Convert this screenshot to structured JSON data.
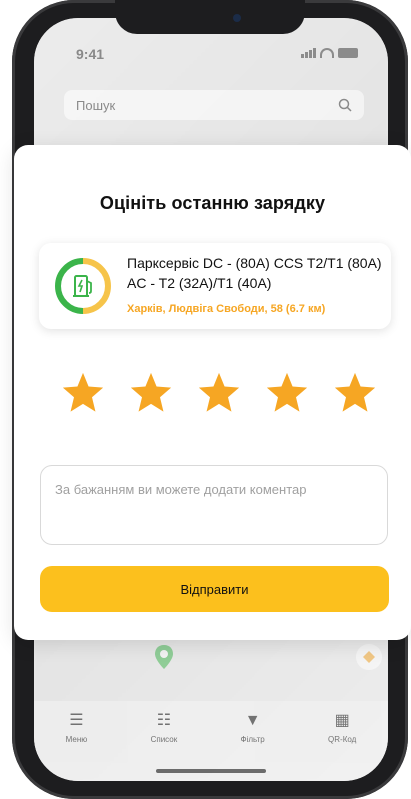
{
  "status_bar": {
    "time": "9:41"
  },
  "search": {
    "placeholder": "Пошук"
  },
  "tab_bar": {
    "items": [
      {
        "label": "Меню",
        "icon": "menu-icon"
      },
      {
        "label": "Список",
        "icon": "list-icon"
      },
      {
        "label": "Фільтр",
        "icon": "filter-icon"
      },
      {
        "label": "QR-Код",
        "icon": "qr-code-icon"
      }
    ]
  },
  "modal": {
    "title": "Оцініть останню зарядку",
    "station": {
      "name": "Парксервіс DC - (80А) CCS T2/T1 (80А) AC - T2 (32А)/T1 (40А)",
      "address": "Харків, Людвіга Свободи, 58 (6.7 км)",
      "icon": "charging-station-icon"
    },
    "rating": {
      "value": 5,
      "max": 5
    },
    "comment_placeholder": "За бажанням ви можете додати коментар",
    "submit_label": "Відправити"
  },
  "colors": {
    "accent": "#fcc01d",
    "star": "#f6a623",
    "address": "#f6a623",
    "station_green": "#3bb44a"
  }
}
